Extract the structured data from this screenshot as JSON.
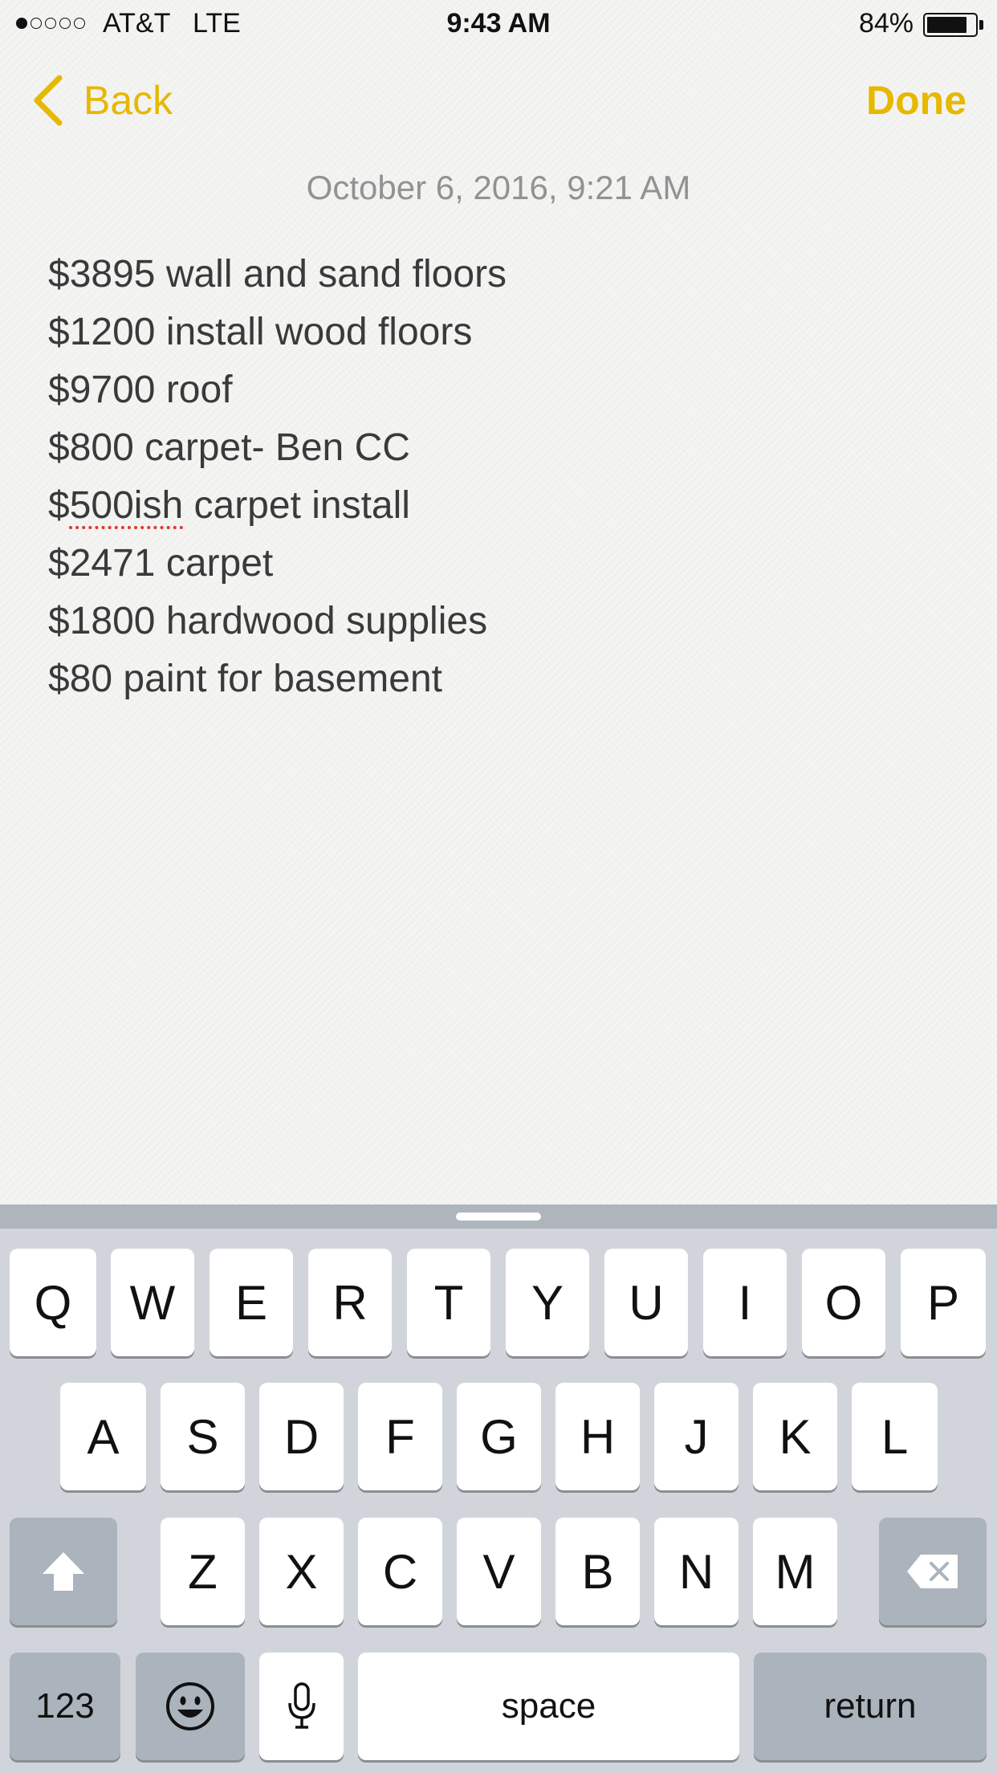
{
  "status_bar": {
    "carrier": "AT&T",
    "network": "LTE",
    "time": "9:43 AM",
    "battery_percent": "84%",
    "battery_level": 0.84,
    "signal_bars_filled": 1,
    "signal_bars_total": 5
  },
  "nav": {
    "back_label": "Back",
    "done_label": "Done",
    "accent_color": "#e6b800"
  },
  "note": {
    "date": "October 6, 2016, 9:21 AM",
    "lines": [
      "$3895 wall and sand floors",
      "$1200 install wood floors",
      "$9700 roof",
      "$800 carpet- Ben CC",
      "$500ish carpet install",
      "$2471 carpet",
      "$1800 hardwood supplies",
      "$80 paint for basement"
    ],
    "misspelled_word": "500ish",
    "misspelled_prefix": "$",
    "misspelled_suffix": " carpet install"
  },
  "keyboard": {
    "row1": [
      "Q",
      "W",
      "E",
      "R",
      "T",
      "Y",
      "U",
      "I",
      "O",
      "P"
    ],
    "row2": [
      "A",
      "S",
      "D",
      "F",
      "G",
      "H",
      "J",
      "K",
      "L"
    ],
    "row3": [
      "Z",
      "X",
      "C",
      "V",
      "B",
      "N",
      "M"
    ],
    "shift_icon": "shift-arrow-icon",
    "delete_icon": "backspace-icon",
    "numbers_label": "123",
    "emoji_icon": "emoji-icon",
    "mic_icon": "microphone-icon",
    "space_label": "space",
    "return_label": "return"
  }
}
